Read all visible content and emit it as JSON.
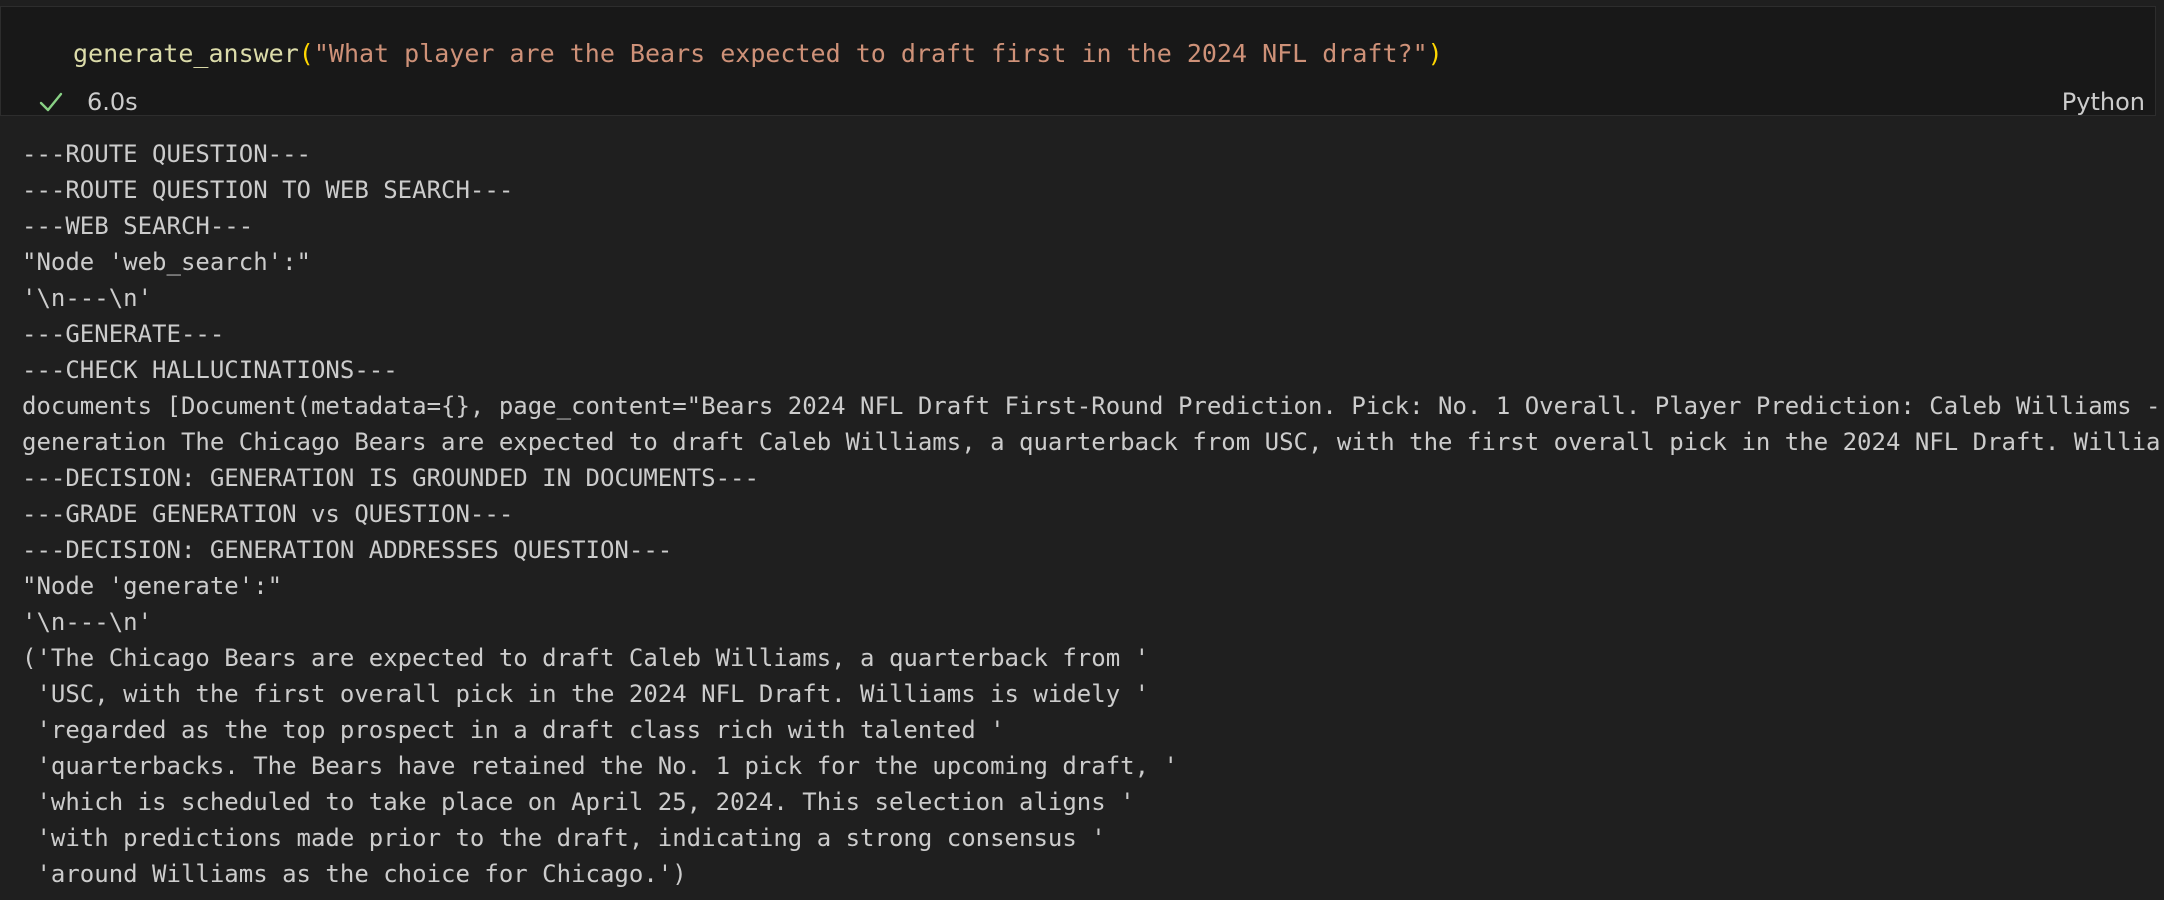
{
  "cell": {
    "code": {
      "function": "generate_answer",
      "open_paren": "(",
      "argument": "\"What player are the Bears expected to draft first in the 2024 NFL draft?\"",
      "close_paren": ")"
    },
    "status": {
      "icon": "check-icon",
      "duration": "6.0s"
    },
    "language": "Python"
  },
  "output": {
    "lines": [
      "---ROUTE QUESTION---",
      "---ROUTE QUESTION TO WEB SEARCH---",
      "---WEB SEARCH---",
      "\"Node 'web_search':\"",
      "'\\n---\\n'",
      "---GENERATE---",
      "---CHECK HALLUCINATIONS---",
      "documents [Document(metadata={}, page_content=\"Bears 2024 NFL Draft First-Round Prediction. Pick: No. 1 Overall. Player Prediction: Caleb Williams -",
      "generation The Chicago Bears are expected to draft Caleb Williams, a quarterback from USC, with the first overall pick in the 2024 NFL Draft. Willia",
      "---DECISION: GENERATION IS GROUNDED IN DOCUMENTS---",
      "---GRADE GENERATION vs QUESTION---",
      "---DECISION: GENERATION ADDRESSES QUESTION---",
      "\"Node 'generate':\"",
      "'\\n---\\n'",
      "('The Chicago Bears are expected to draft Caleb Williams, a quarterback from '",
      " 'USC, with the first overall pick in the 2024 NFL Draft. Williams is widely '",
      " 'regarded as the top prospect in a draft class rich with talented '",
      " 'quarterbacks. The Bears have retained the No. 1 pick for the upcoming draft, '",
      " 'which is scheduled to take place on April 25, 2024. This selection aligns '",
      " 'with predictions made prior to the draft, indicating a strong consensus '",
      " 'around Williams as the choice for Chicago.')"
    ]
  },
  "colors": {
    "background": "#1f1f1f",
    "editor_background": "#181818",
    "function": "#dcdcaa",
    "bracket": "#ffd700",
    "string": "#ce9178",
    "success_check": "#89d185",
    "output_text": "#cccccc"
  }
}
